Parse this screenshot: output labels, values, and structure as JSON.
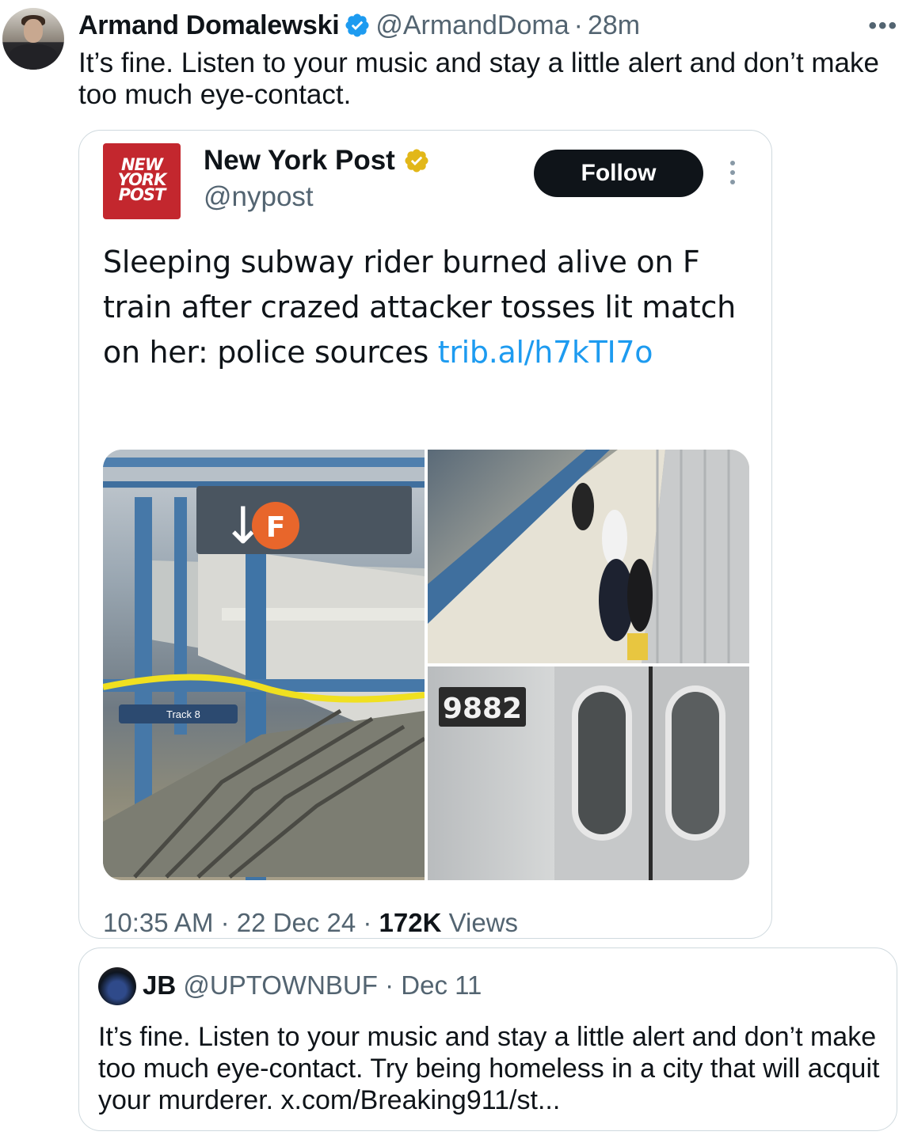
{
  "tweet": {
    "author_name": "Armand Domalewski",
    "handle": "@ArmandDoma",
    "separator": "·",
    "time": "28m",
    "more": "•••",
    "text": "It’s fine. Listen to your music and stay a little alert and don’t make too much eye-contact."
  },
  "embed": {
    "logo_lines": [
      "NEW",
      "YORK",
      "POST"
    ],
    "name": "New York Post",
    "handle": "@nypost",
    "follow_label": "Follow",
    "text": "Sleeping subway rider burned alive on F train after crazed attacker tosses lit match on her: police sources ",
    "link": "trib.al/h7kTI7o",
    "photos": {
      "sign_letter": "F",
      "track_label": "Track 8",
      "car_number": "9882"
    },
    "footer": {
      "time": "10:35 AM",
      "sep1": " · ",
      "date": "22 Dec 24",
      "sep2": " · ",
      "views_count": "172K",
      "views_label": " Views"
    }
  },
  "quote": {
    "name": "JB",
    "handle": "@UPTOWNBUF",
    "separator": "·",
    "date": "Dec 11",
    "text": "It’s fine. Listen to your music and stay a little alert and don’t make too much eye-contact. Try being homeless in a city that will acquit your murderer. x.com/Breaking911/st..."
  },
  "colors": {
    "verified_blue": "#1d9bf0",
    "verified_gold": "#e2b719",
    "link_blue": "#1d9bf0",
    "nyp_red": "#c3272e",
    "mta_orange": "#e8662b",
    "mta_blue": "#3a6ea5"
  }
}
